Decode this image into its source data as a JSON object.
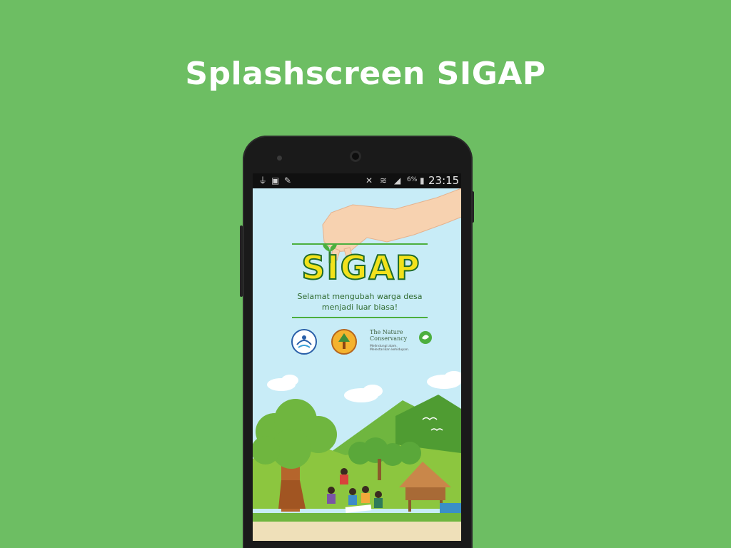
{
  "slide": {
    "title": "Splashscreen SIGAP",
    "background_color": "#6dbe63"
  },
  "status_bar": {
    "left_icons": [
      "usb-icon",
      "message-icon",
      "pencil-icon"
    ],
    "right_icons": [
      "mute-icon",
      "wifi-icon",
      "signal-icon",
      "battery-icon"
    ],
    "battery_percent": "6%",
    "time": "23:15"
  },
  "splash": {
    "app_name": "SIGAP",
    "tagline_line1": "Selamat mengubah warga desa",
    "tagline_line2": "menjadi luar biasa!",
    "partners": {
      "tnc_name_line1": "The Nature",
      "tnc_name_line2": "Conservancy",
      "tnc_slogan_line1": "Melindungi alam.",
      "tnc_slogan_line2": "Melestarikan kehidupan."
    },
    "colors": {
      "sky": "#c8ecf7",
      "logo_yellow": "#f2e21b",
      "logo_outline": "#1f6b2a",
      "grass": "#8cc63f"
    }
  }
}
